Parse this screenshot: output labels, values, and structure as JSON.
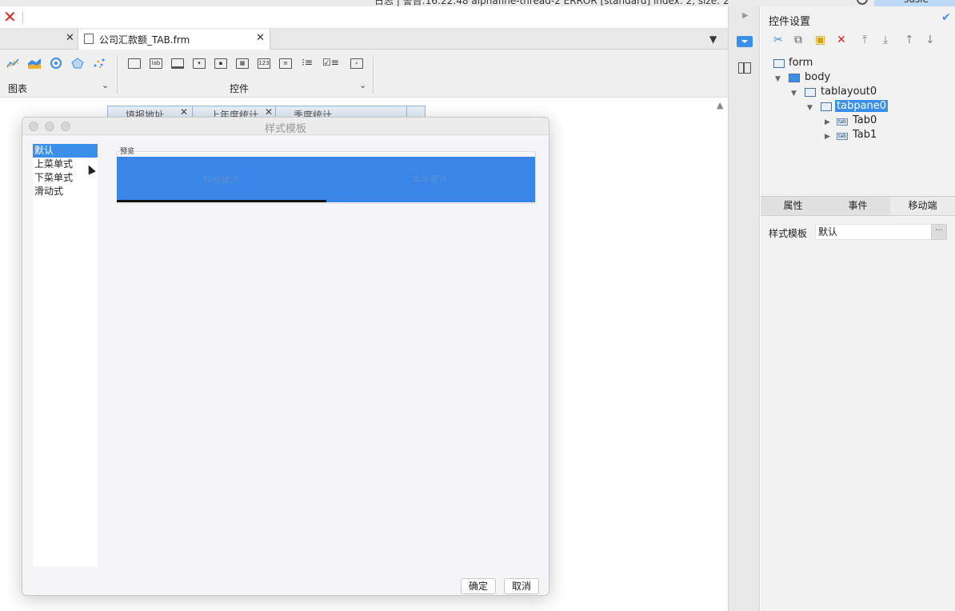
{
  "topbar": {
    "log_text": "日志 | 警告:16:22:48 alphafine-thread-2 ERROR [standard] index: 2, size: 2",
    "user": "susie"
  },
  "tabs": {
    "doc_tab_title": "公司汇款额_TAB.frm"
  },
  "toolbar": {
    "group_chart": "图表",
    "group_controls": "控件",
    "lab_icon": "lab",
    "num_icon": "123"
  },
  "canvas": {
    "bg_tab_labels": [
      "填报地址",
      "上年度统计",
      "季度统计"
    ]
  },
  "dialog": {
    "title": "样式模板",
    "styles": [
      "默认",
      "上菜单式",
      "下菜单式",
      "滑动式"
    ],
    "selected_style": "默认",
    "preview_label": "预览",
    "preview_tabs": [
      "快报统计",
      "本年累计"
    ],
    "ok": "确定",
    "cancel": "取消"
  },
  "right_panel": {
    "title": "控件设置",
    "tree": [
      "form",
      "body",
      "tablayout0",
      "tabpane0",
      "Tab0",
      "Tab1"
    ],
    "selected_node": "tabpane0",
    "tab_icon_text": "tab",
    "prop_tabs": [
      "属性",
      "事件",
      "移动端"
    ],
    "active_prop_tab": "移动端",
    "style_label": "样式模板",
    "style_value": "默认",
    "more": "···"
  },
  "colors": {
    "accent": "#3b8fe8",
    "close_red": "#e02020",
    "preview_blue": "#3a86e8"
  }
}
